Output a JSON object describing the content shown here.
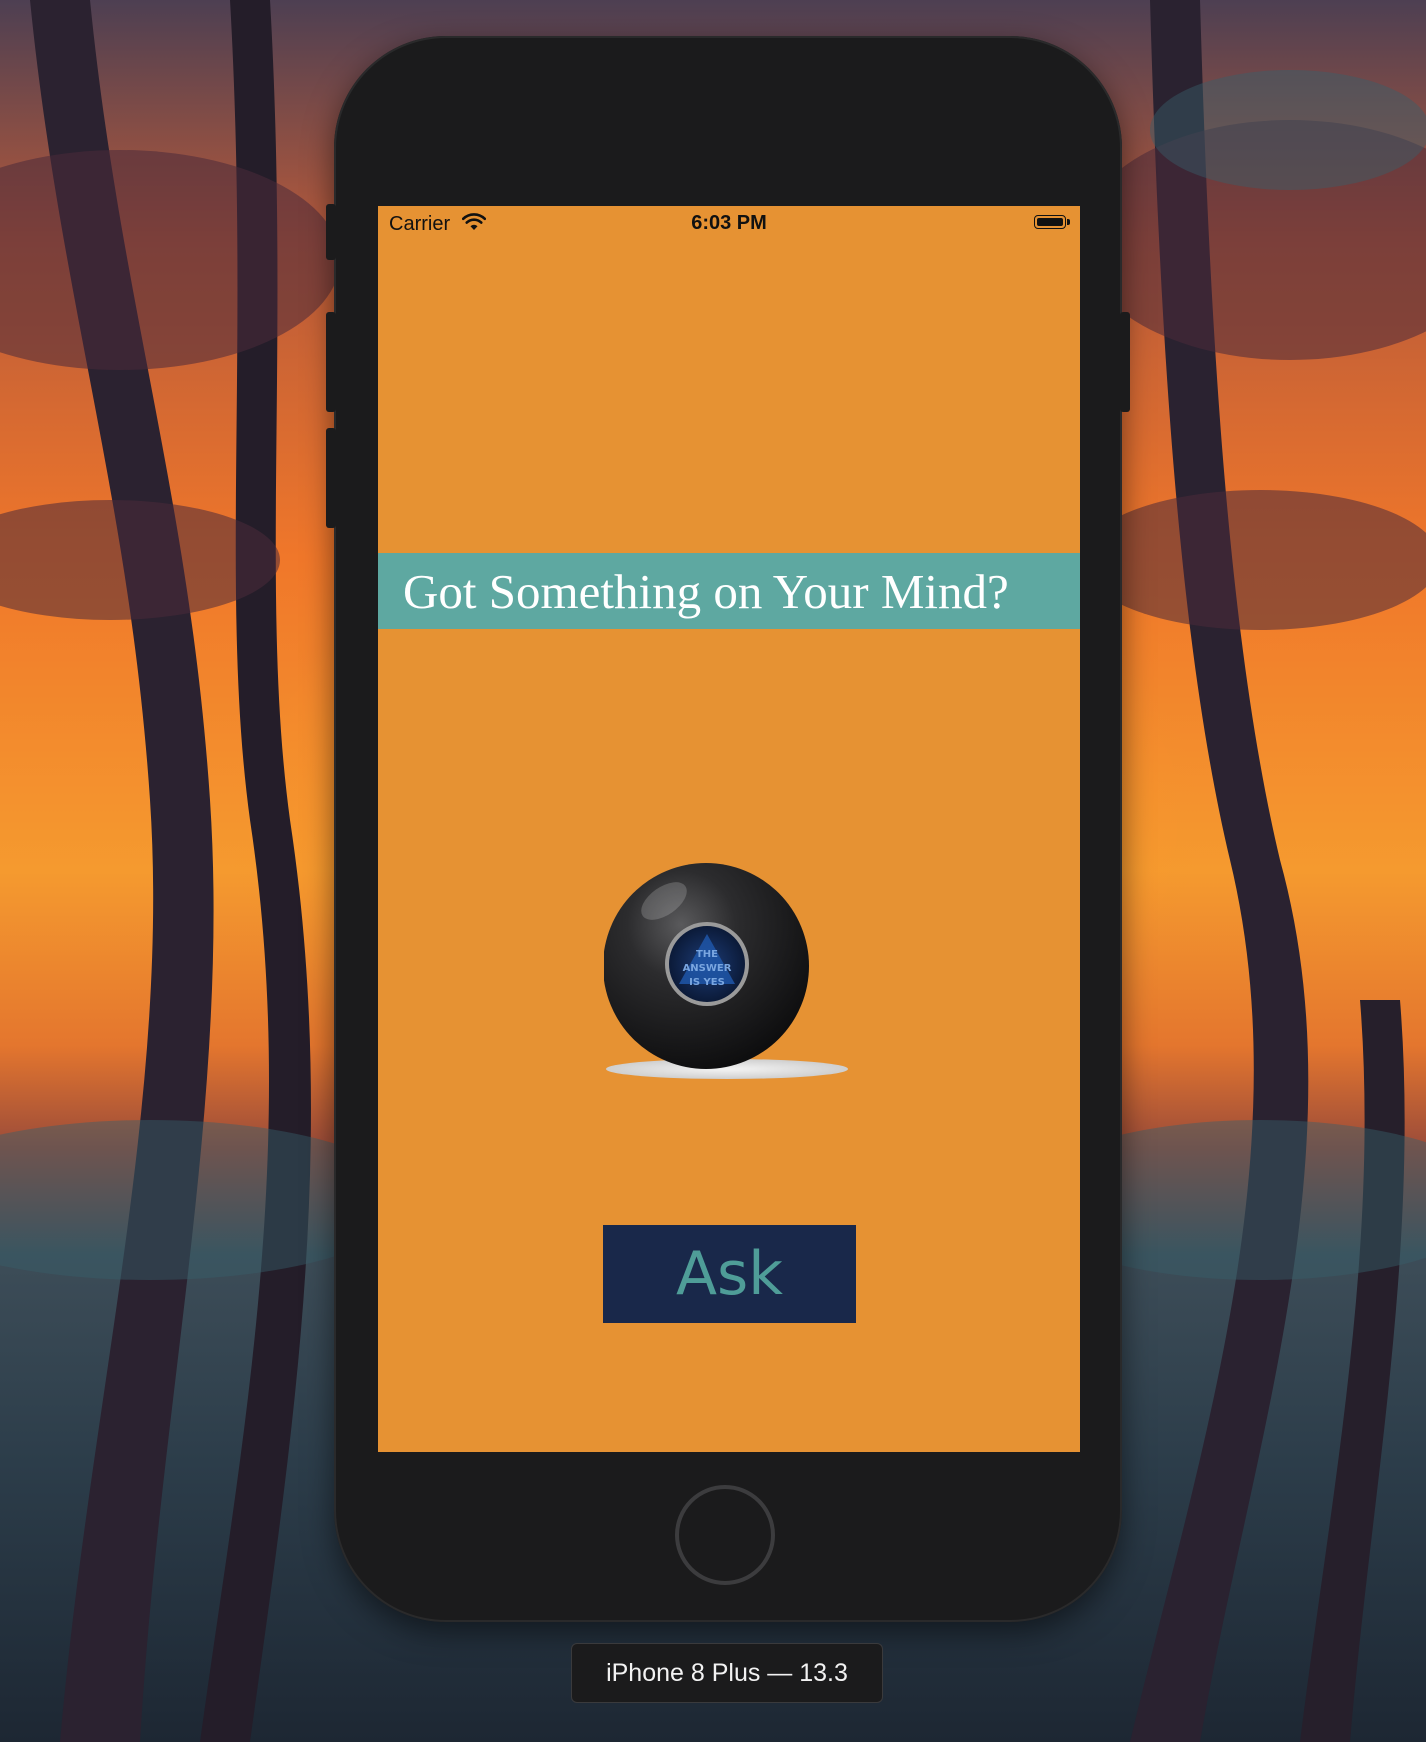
{
  "status_bar": {
    "carrier": "Carrier",
    "time": "6:03 PM"
  },
  "app": {
    "title": "Got Something on Your Mind?",
    "ball_text": [
      "THE",
      "ANSWER",
      "IS YES"
    ],
    "ask_button_label": "Ask",
    "colors": {
      "background": "#e69233",
      "banner": "#5ea8a1",
      "button": "#19284a",
      "button_text": "#4f9d98"
    }
  },
  "simulator": {
    "device_label": "iPhone 8 Plus — 13.3"
  }
}
